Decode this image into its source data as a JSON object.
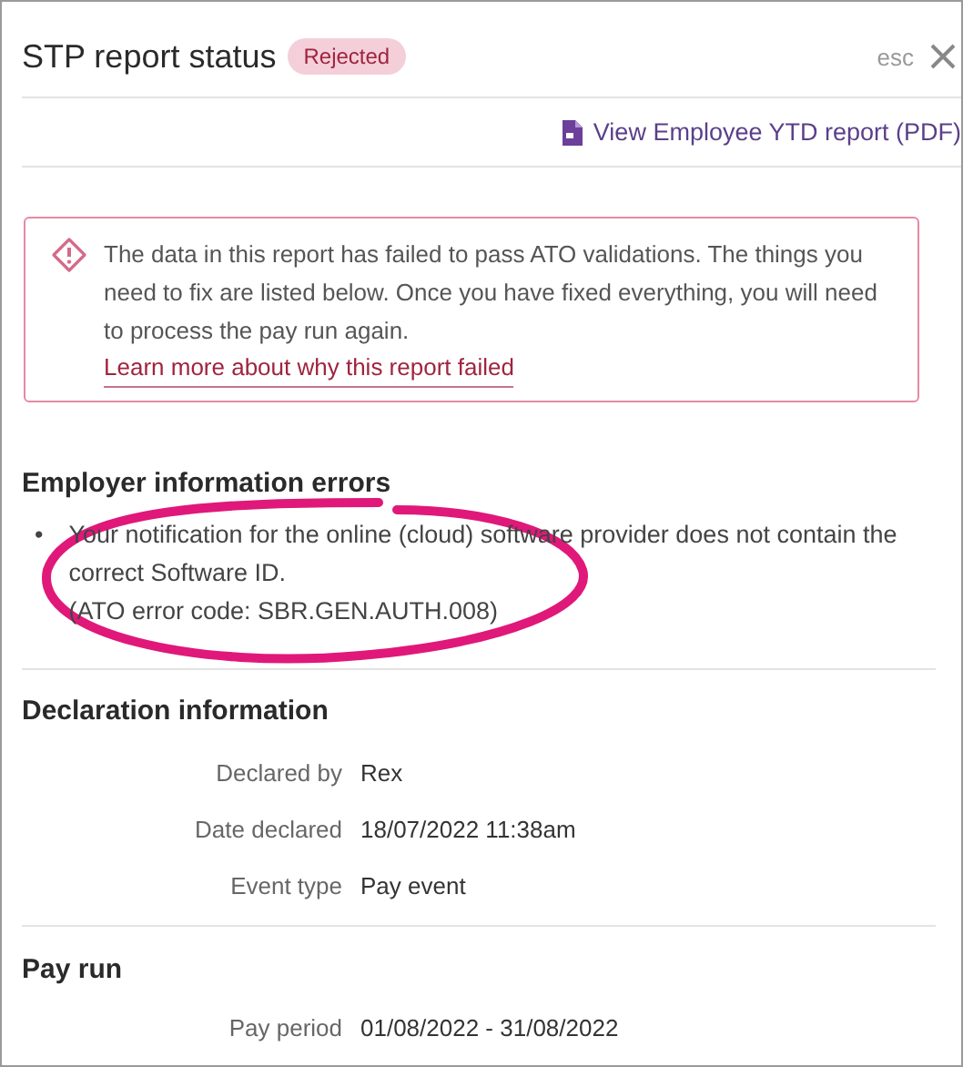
{
  "header": {
    "title": "STP report status",
    "status_badge": "Rejected",
    "esc_hint": "esc"
  },
  "report_link": "View Employee YTD report (PDF)",
  "alert": {
    "message": "The data in this report has failed to pass ATO validations. The things you need to fix are listed below. Once you have fixed everything, you will need to process the pay run again.",
    "link": "Learn more about why this report failed"
  },
  "employer_errors": {
    "heading": "Employer information errors",
    "items": [
      {
        "bullet": "•",
        "text": "Your notification for the online (cloud) software provider does not contain the correct Software ID.",
        "code": "(ATO error code: SBR.GEN.AUTH.008)",
        "highlighted": true
      }
    ]
  },
  "declaration": {
    "heading": "Declaration information",
    "fields": [
      {
        "label": "Declared by",
        "value": "Rex"
      },
      {
        "label": "Date declared",
        "value": "18/07/2022 11:38am"
      },
      {
        "label": "Event type",
        "value": "Pay event"
      }
    ]
  },
  "pay_run": {
    "heading": "Pay run",
    "fields": [
      {
        "label": "Pay period",
        "value": "01/08/2022 - 31/08/2022"
      }
    ]
  }
}
